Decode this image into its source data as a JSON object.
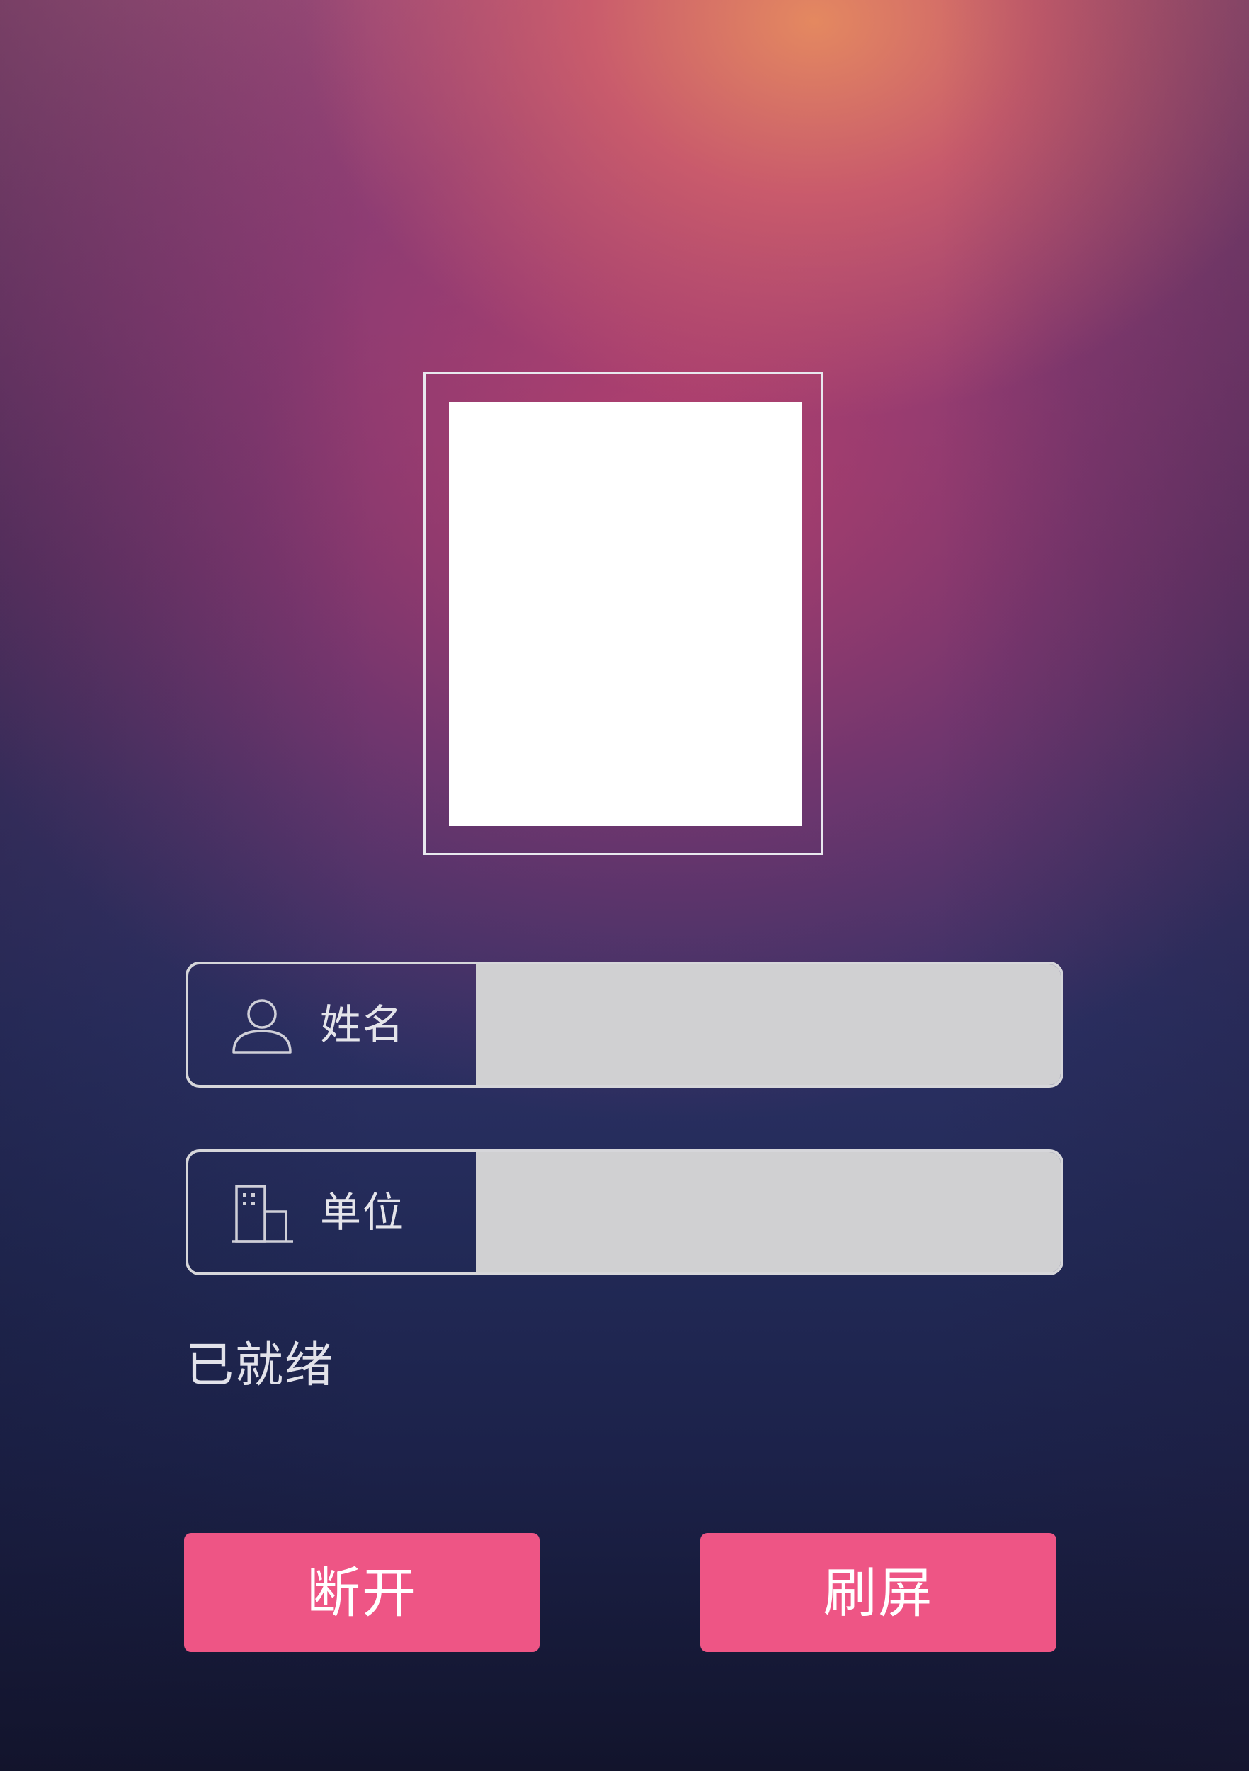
{
  "photo": {
    "frame_color": "#e8e8ee",
    "fill_color": "#ffffff"
  },
  "form": {
    "name_field": {
      "label": "姓名",
      "icon": "person-icon",
      "value": "",
      "placeholder": ""
    },
    "unit_field": {
      "label": "单位",
      "icon": "building-icon",
      "value": "",
      "placeholder": ""
    }
  },
  "status": {
    "text": "已就绪"
  },
  "buttons": {
    "disconnect_label": "断开",
    "refresh_label": "刷屏"
  },
  "colors": {
    "button_accent": "#ee5585",
    "input_background": "#d0d0d2",
    "field_border": "#d6d6da"
  }
}
